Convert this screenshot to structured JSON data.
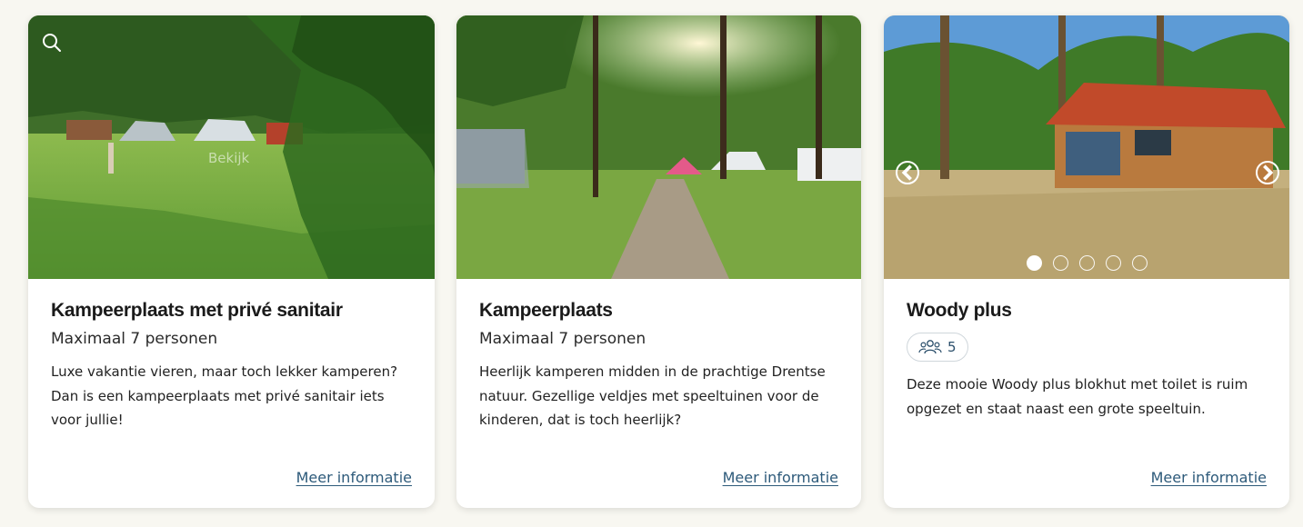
{
  "cards": [
    {
      "title": "Kampeerplaats met privé sanitair",
      "subtitle": "Maximaal 7 personen",
      "description": "Luxe vakantie vieren, maar toch lekker kamperen? Dan is een kampeerplaats met privé sanitair iets voor jullie!",
      "link_label": "Meer informatie",
      "image_overlay_text": "Bekijk",
      "image_icon": "search-icon"
    },
    {
      "title": "Kampeerplaats",
      "subtitle": "Maximaal 7 personen",
      "description": "Heerlijk kamperen midden in de prachtige Drentse natuur. Gezellige veldjes met speeltuinen voor de kinderen, dat is toch heerlijk?",
      "link_label": "Meer informatie"
    },
    {
      "title": "Woody plus",
      "persons_icon": "people-icon",
      "persons_count": "5",
      "description": "Deze mooie Woody plus blokhut met toilet is ruim opgezet en staat naast een grote speeltuin.",
      "link_label": "Meer informatie",
      "carousel": {
        "slide_count": 5,
        "active_slide": 1
      }
    }
  ],
  "colors": {
    "background": "#f8f7f1",
    "card": "#ffffff",
    "link": "#2d5a7a",
    "heading": "#1a1a1a"
  }
}
